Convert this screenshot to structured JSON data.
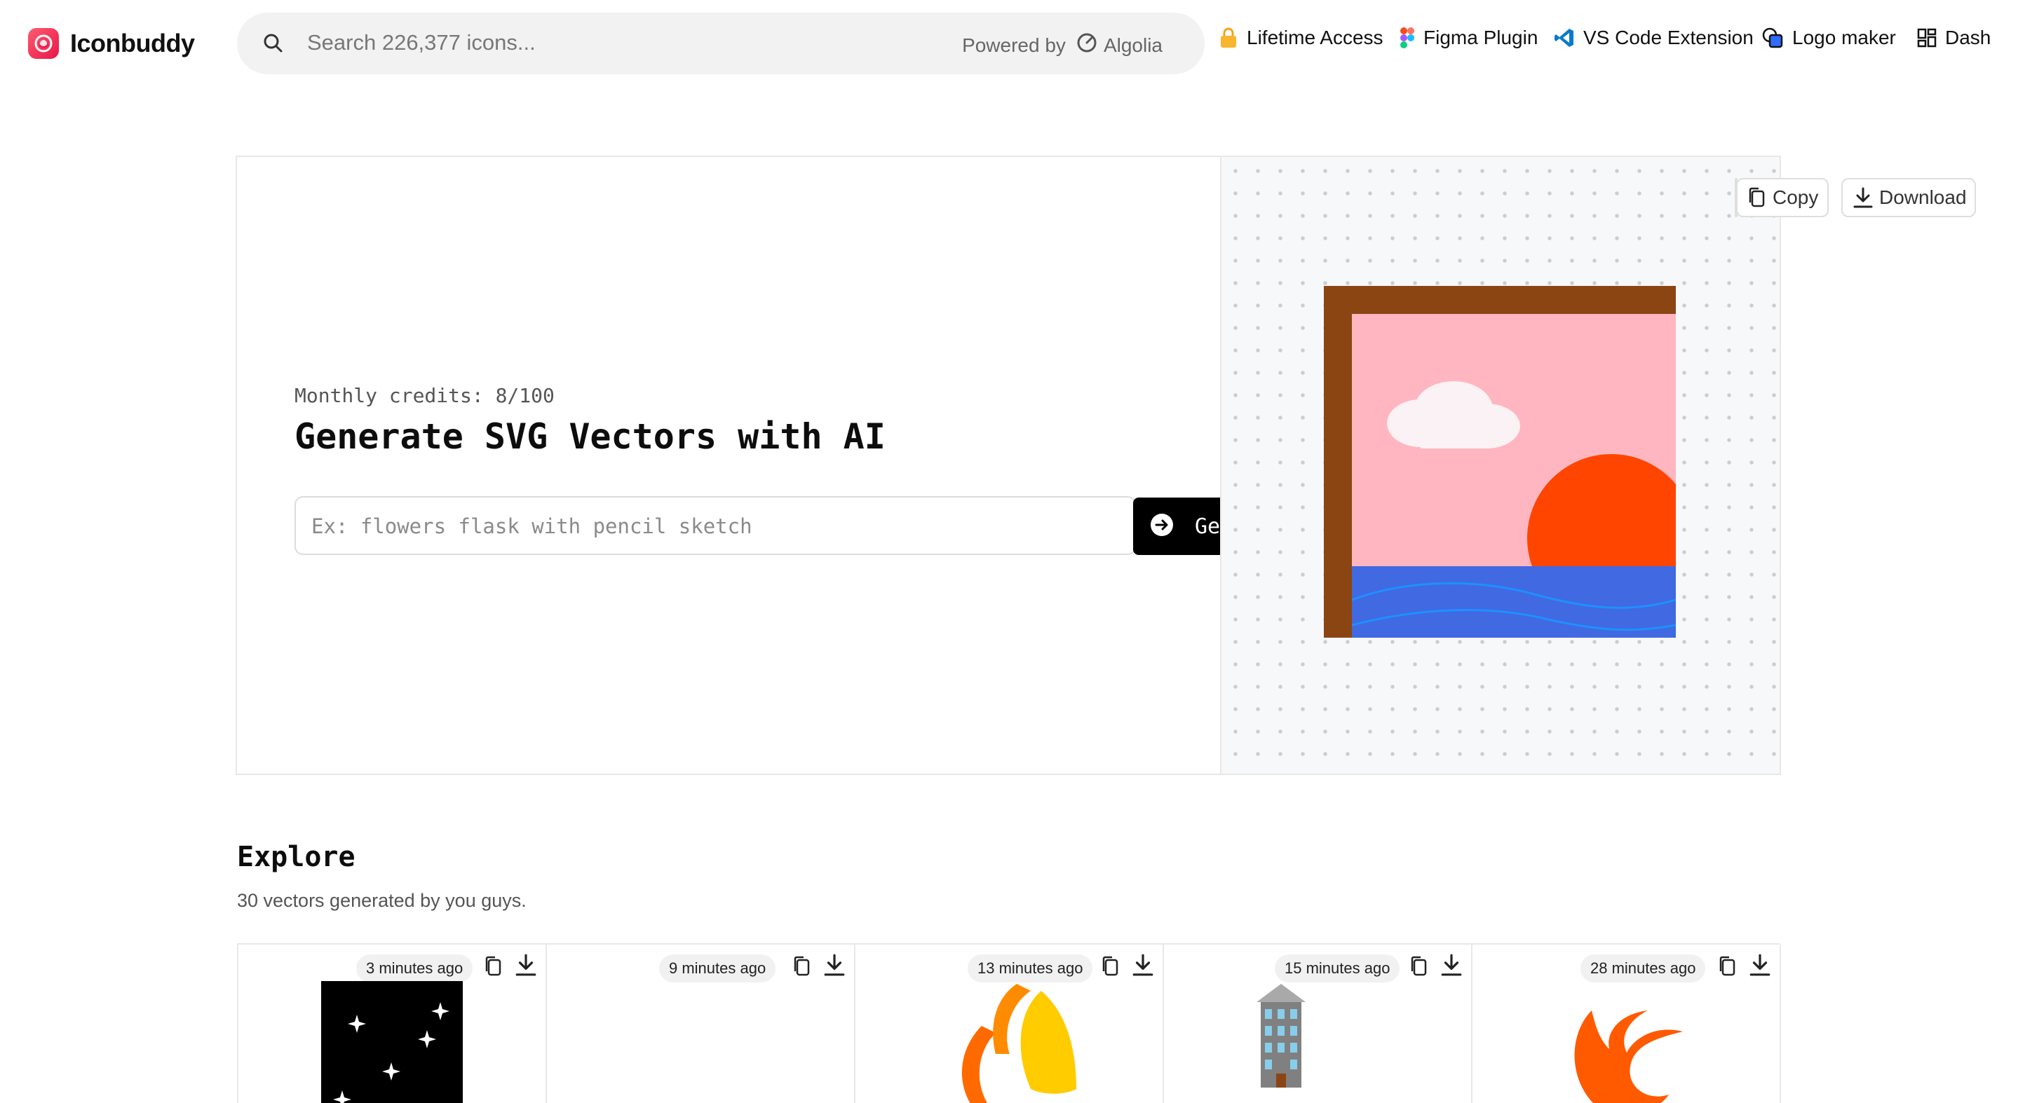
{
  "brand": {
    "name": "Iconbuddy"
  },
  "search": {
    "placeholder": "Search 226,377 icons...",
    "powered_by": "Powered by",
    "provider": "Algolia"
  },
  "nav": [
    {
      "label": "Lifetime Access",
      "icon": "lock-icon"
    },
    {
      "label": "Figma Plugin",
      "icon": "figma-icon"
    },
    {
      "label": "VS Code Extension",
      "icon": "vscode-icon"
    },
    {
      "label": "Logo maker",
      "icon": "logo-maker-icon"
    },
    {
      "label": "Dash",
      "icon": "dashboard-icon"
    }
  ],
  "hero": {
    "credits": "Monthly credits: 8/100",
    "title": "Generate SVG Vectors with AI",
    "prompt_placeholder": "Ex: flowers flask with pencil sketch",
    "generate_label": "Generate",
    "copy_label": "Copy",
    "download_label": "Download",
    "artwork": "framed-sunset-icon"
  },
  "explore": {
    "title": "Explore",
    "subtitle": "30 vectors generated by you guys.",
    "cards": [
      {
        "time": "3 minutes ago",
        "thumb": "starry-night-icon"
      },
      {
        "time": "9 minutes ago",
        "thumb": "blank-icon"
      },
      {
        "time": "13 minutes ago",
        "thumb": "flame-slices-icon"
      },
      {
        "time": "15 minutes ago",
        "thumb": "building-icon"
      },
      {
        "time": "28 minutes ago",
        "thumb": "fire-icon"
      }
    ]
  },
  "colors": {
    "accent": "#000000",
    "brand": "#e8174b",
    "canvas_bg": "#f7f8fa"
  }
}
